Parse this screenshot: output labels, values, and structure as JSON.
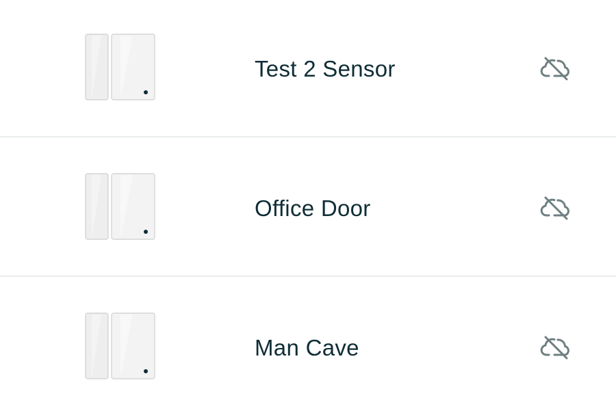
{
  "devices": [
    {
      "name": "Test 2 Sensor",
      "device_icon": "entry-sensor-icon",
      "status_icon": "cloud-offline-icon"
    },
    {
      "name": "Office Door",
      "device_icon": "entry-sensor-icon",
      "status_icon": "cloud-offline-icon"
    },
    {
      "name": "Man Cave",
      "device_icon": "entry-sensor-icon",
      "status_icon": "cloud-offline-icon"
    }
  ],
  "colors": {
    "text": "#0f2d36",
    "icon": "#6f7f81",
    "divider": "#e9ecec",
    "sensor_fill": "#eeeeee",
    "sensor_dot": "#0f2d36"
  }
}
